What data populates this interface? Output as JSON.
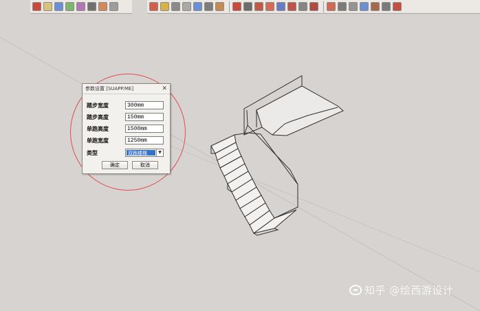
{
  "toolbars": {
    "left_icons": [
      "material-icon",
      "paint-icon",
      "layers-icon",
      "component-icon",
      "texture-icon",
      "shadow-icon",
      "style-icon",
      "scene-icon"
    ],
    "right_icons": [
      "arc-icon",
      "mirror-icon",
      "copy-icon",
      "array-icon",
      "align-icon",
      "fill-icon",
      "cut-icon",
      "snap-icon",
      "line-icon",
      "corner-icon",
      "offset-icon",
      "cap-icon",
      "path-icon",
      "curve-icon",
      "edit-icon",
      "settings-icon",
      "tape-icon",
      "rotate-icon",
      "sphere-icon",
      "box-icon",
      "render-icon",
      "export-icon"
    ]
  },
  "dialog": {
    "title": "参数设置 [SUAPP.ME]",
    "close_label": "✕",
    "fields": [
      {
        "label": "踏步宽度",
        "value": "300mm"
      },
      {
        "label": "踏步高度",
        "value": "150mm"
      },
      {
        "label": "单跑高度",
        "value": "1500mm"
      },
      {
        "label": "单跑宽度",
        "value": "1250mm"
      }
    ],
    "type_label": "类型",
    "type_value": "双跑楼梯",
    "ok_label": "确定",
    "cancel_label": "取消"
  },
  "watermark": {
    "text": "知乎 @绘西游设计"
  },
  "colors": {
    "viewport": "#d6d3d0",
    "highlight": "#e04d4e",
    "selection": "#3471c7"
  }
}
